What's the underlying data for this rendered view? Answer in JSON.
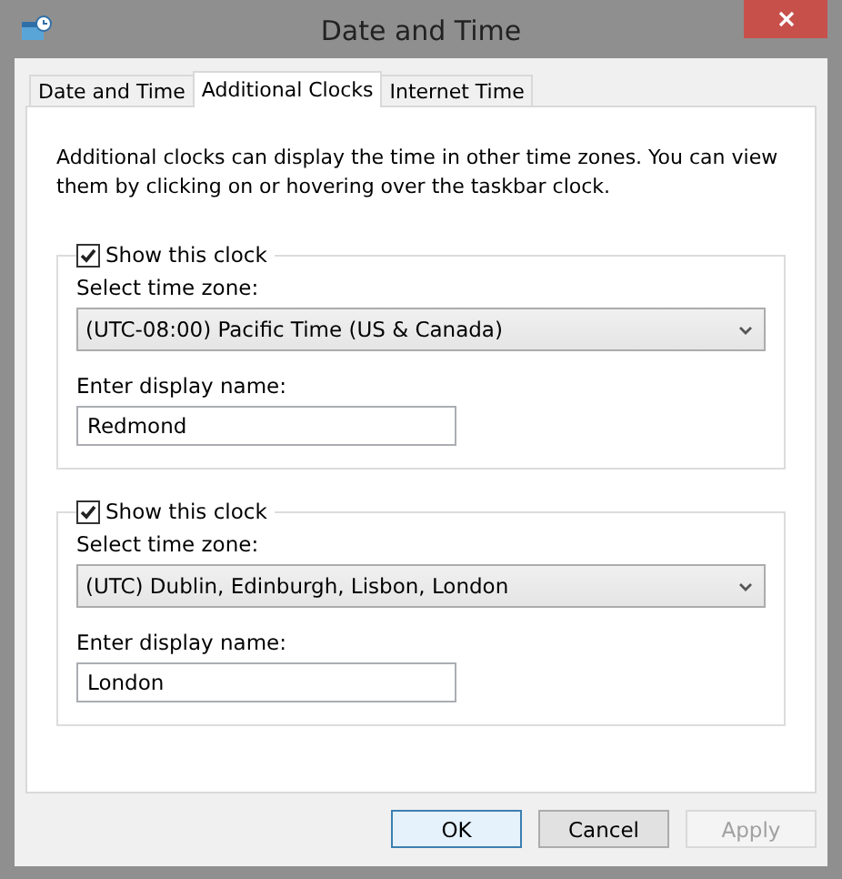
{
  "window": {
    "title": "Date and Time"
  },
  "tabs": [
    {
      "label": "Date and Time",
      "selected": false
    },
    {
      "label": "Additional Clocks",
      "selected": true
    },
    {
      "label": "Internet Time",
      "selected": false
    }
  ],
  "description": "Additional clocks can display the time in other time zones. You can view them by clicking on or hovering over the taskbar clock.",
  "clocks": [
    {
      "show_label": "Show this clock",
      "checked": true,
      "zone_label": "Select time zone:",
      "zone": "(UTC-08:00) Pacific Time (US & Canada)",
      "name_label": "Enter display name:",
      "name": "Redmond"
    },
    {
      "show_label": "Show this clock",
      "checked": true,
      "zone_label": "Select time zone:",
      "zone": "(UTC) Dublin, Edinburgh, Lisbon, London",
      "name_label": "Enter display name:",
      "name": "London"
    }
  ],
  "buttons": [
    {
      "label": "OK",
      "kind": "default",
      "disabled": false
    },
    {
      "label": "Cancel",
      "kind": "normal",
      "disabled": false
    },
    {
      "label": "Apply",
      "kind": "normal",
      "disabled": true
    }
  ]
}
